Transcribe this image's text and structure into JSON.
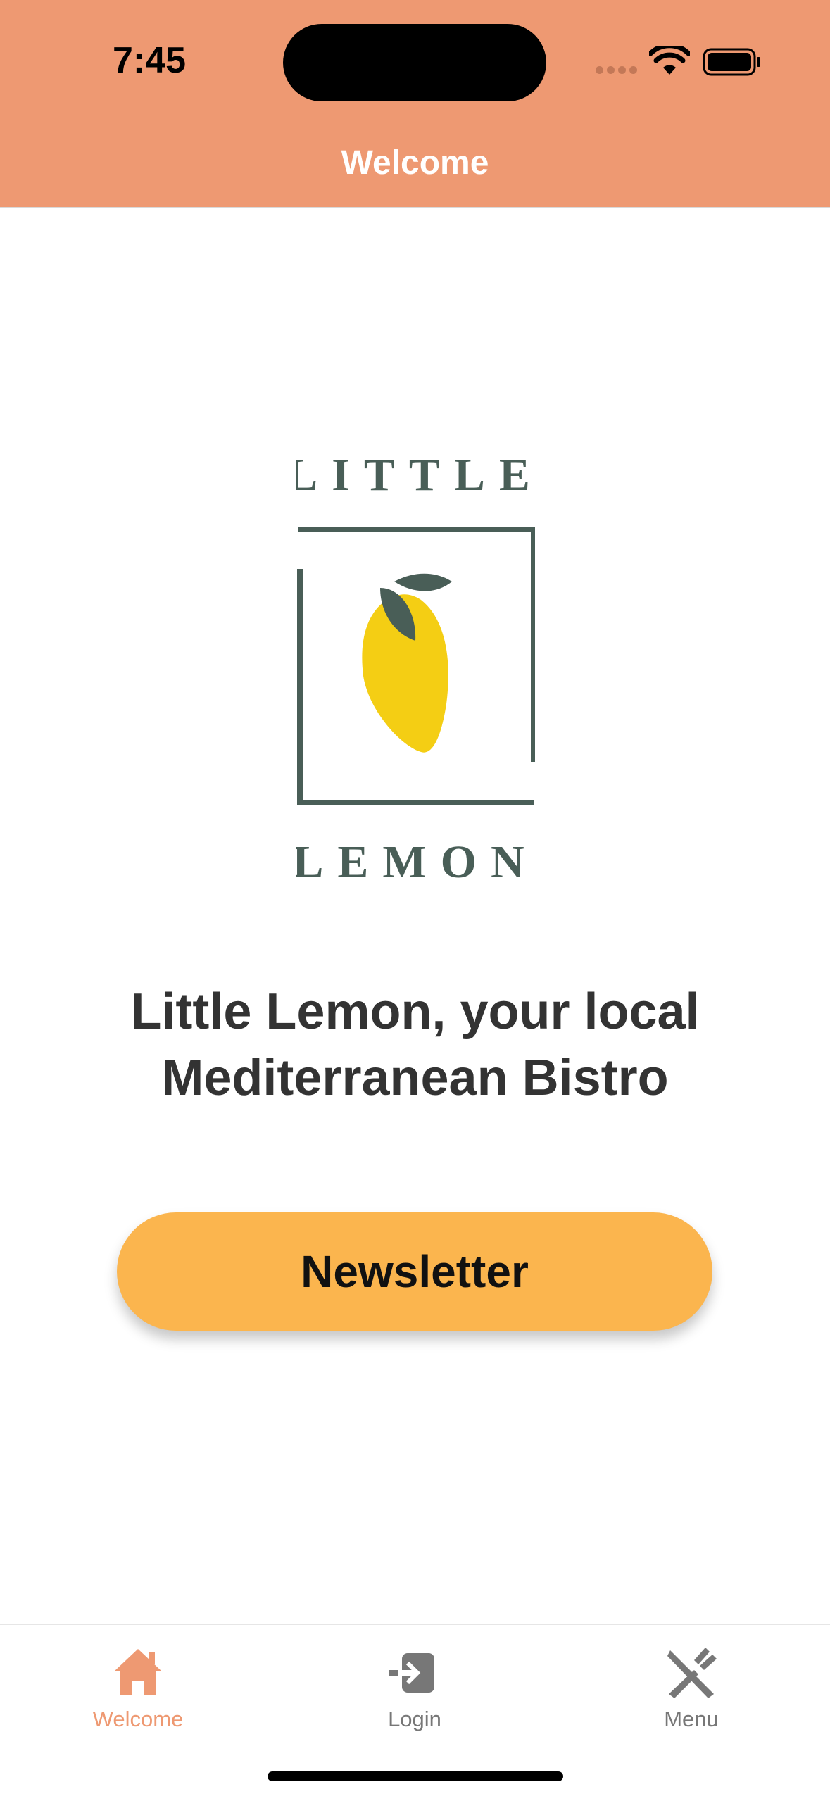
{
  "status_bar": {
    "time": "7:45"
  },
  "header": {
    "title": "Welcome"
  },
  "logo": {
    "line1": "LITTLE",
    "line2": "LEMON"
  },
  "main": {
    "tagline_line1": "Little Lemon, your local",
    "tagline_line2": "Mediterranean Bistro",
    "newsletter_label": "Newsletter"
  },
  "tabs": [
    {
      "label": "Welcome",
      "icon": "house-icon",
      "active": true
    },
    {
      "label": "Login",
      "icon": "login-icon",
      "active": false
    },
    {
      "label": "Menu",
      "icon": "fork-knife-icon",
      "active": false
    }
  ],
  "colors": {
    "header": "#EE9972",
    "accent_button": "#FBB54E",
    "active_tab": "#EE9972",
    "inactive_tab": "#777777",
    "logo_green": "#495E57",
    "lemon_yellow": "#F4CE14",
    "text_dark": "#333333"
  }
}
